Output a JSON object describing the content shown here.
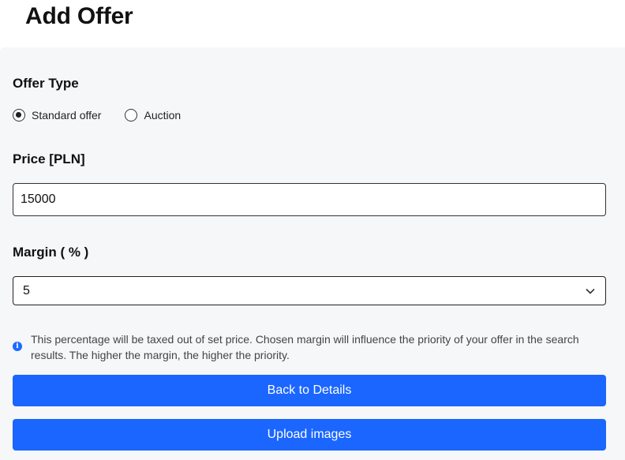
{
  "page": {
    "title": "Add Offer"
  },
  "offer_type": {
    "label": "Offer Type",
    "options": [
      {
        "label": "Standard offer",
        "checked": true
      },
      {
        "label": "Auction",
        "checked": false
      }
    ]
  },
  "price": {
    "label": "Price [PLN]",
    "value": "15000"
  },
  "margin": {
    "label": "Margin ( % )",
    "selected": "5",
    "info_text": "This percentage will be taxed out of set price. Chosen margin will influence the priority of your offer in the search results. The higher the margin, the higher the priority."
  },
  "buttons": {
    "back_label": "Back to Details",
    "upload_label": "Upload images"
  },
  "colors": {
    "accent": "#1a66ff",
    "panel_bg": "#f6f7f9",
    "info_icon": "#1a6cff"
  },
  "icons": {
    "select_chevron": "chevron-down-icon",
    "info": "info-icon"
  }
}
